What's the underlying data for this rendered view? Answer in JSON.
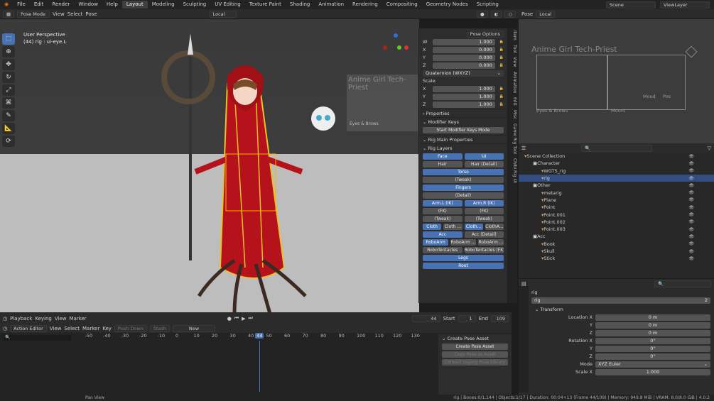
{
  "topbar": {
    "menus": [
      "File",
      "Edit",
      "Render",
      "Window",
      "Help"
    ],
    "workspaces": [
      "Layout",
      "Modeling",
      "Sculpting",
      "UV Editing",
      "Texture Paint",
      "Shading",
      "Animation",
      "Rendering",
      "Compositing",
      "Geometry Nodes",
      "Scripting"
    ],
    "active_workspace": "Layout",
    "scene": "Scene",
    "view_layer": "ViewLayer"
  },
  "viewport_header": {
    "mode": "Pose Mode",
    "menus": [
      "View",
      "Select",
      "Pose"
    ],
    "orientation": "Local",
    "pose_options": "Pose Options"
  },
  "viewport": {
    "perspective": "User Perspective",
    "selection": "(44) rig : ui-eye.L",
    "overlay_title": "Anime Girl Tech-Priest",
    "overlay_label": "Eyes & Brows"
  },
  "npanel": {
    "transform_rows": [
      {
        "label": "W",
        "value": "1.000"
      },
      {
        "label": "X",
        "value": "0.000"
      },
      {
        "label": "Y",
        "value": "0.000"
      },
      {
        "label": "Z",
        "value": "0.000"
      }
    ],
    "rotation_mode": "Quaternion (WXYZ)",
    "scale_label": "Scale:",
    "scale_rows": [
      {
        "label": "X",
        "value": "1.000"
      },
      {
        "label": "Y",
        "value": "1.000"
      },
      {
        "label": "Z",
        "value": "1.000"
      }
    ],
    "properties": "Properties",
    "modifier_keys": "Modifier Keys",
    "start_modifier": "Start Modifier Keys Mode",
    "rig_main": "Rig Main Properties",
    "rig_layers": "Rig Layers",
    "layers": [
      [
        "Face",
        "UI"
      ],
      [
        "Hair",
        "Hair (Detail)"
      ],
      [
        "Torso"
      ],
      [
        "(Tweak)"
      ],
      [
        "Fingers"
      ],
      [
        "(Detail)"
      ],
      [
        "Arm.L (IK)",
        "Arm.R (IK)"
      ],
      [
        "(FK)",
        "(FK)"
      ],
      [
        "(Tweak)",
        "(Tweak)"
      ],
      [
        "Cloth",
        "Cloth ...",
        "Cloth...",
        "ClothA..."
      ],
      [
        "Acc",
        "Acc (Detail)"
      ],
      [
        "RoboArm",
        "RoboArm ...",
        "RoboArm ..."
      ],
      [
        "RoboTentacles",
        "RoboTentacles (FK)"
      ],
      [
        "Legs"
      ],
      [
        "Root"
      ]
    ]
  },
  "vtabs": [
    "Item",
    "Tool",
    "View",
    "Animation",
    "Edit",
    "Misc",
    "Game Rig Tool",
    "Chibi Rig UI"
  ],
  "right_preview": {
    "title": "Anime Girl Tech-Priest",
    "labels": [
      "Eyes & Brows",
      "Mount",
      "Mood",
      "Pos"
    ]
  },
  "outliner": {
    "search_placeholder": "",
    "items": [
      {
        "label": "Scene Collection",
        "indent": 0
      },
      {
        "label": "Character",
        "indent": 1
      },
      {
        "label": "WGTS_rig",
        "indent": 2
      },
      {
        "label": "rig",
        "indent": 2,
        "selected": true
      },
      {
        "label": "Other",
        "indent": 1
      },
      {
        "label": "metarig",
        "indent": 2
      },
      {
        "label": "Plane",
        "indent": 2
      },
      {
        "label": "Point",
        "indent": 2
      },
      {
        "label": "Point.001",
        "indent": 2
      },
      {
        "label": "Point.002",
        "indent": 2
      },
      {
        "label": "Point.003",
        "indent": 2
      },
      {
        "label": "Acc",
        "indent": 1
      },
      {
        "label": "Book",
        "indent": 2
      },
      {
        "label": "Skull",
        "indent": 2
      },
      {
        "label": "Stick",
        "indent": 2
      }
    ]
  },
  "properties": {
    "object_name": "rig",
    "data_name": "rig",
    "users": "2",
    "transform": "Transform",
    "location": [
      {
        "label": "Location X",
        "value": "0 m"
      },
      {
        "label": "Y",
        "value": "0 m"
      },
      {
        "label": "Z",
        "value": "0 m"
      }
    ],
    "rotation": [
      {
        "label": "Rotation X",
        "value": "0°"
      },
      {
        "label": "Y",
        "value": "0°"
      },
      {
        "label": "Z",
        "value": "0°"
      }
    ],
    "mode_label": "Mode",
    "mode_value": "XYZ Euler",
    "scale_label": "Scale X",
    "scale_value": "1.000"
  },
  "timeline": {
    "menus": [
      "Playback",
      "Keying",
      "View",
      "Marker"
    ],
    "current_frame": "44",
    "start_label": "Start",
    "start": "1",
    "end_label": "End",
    "end": "109"
  },
  "action_editor": {
    "mode": "Action Editor",
    "menus": [
      "View",
      "Select",
      "Marker",
      "Key"
    ],
    "push_down": "Push Down",
    "stash": "Stash",
    "new": "New",
    "ticks": [
      "-50",
      "-40",
      "-30",
      "-20",
      "-10",
      "0",
      "10",
      "20",
      "30",
      "40",
      "44",
      "50",
      "60",
      "70",
      "80",
      "90",
      "100",
      "110",
      "120",
      "130"
    ]
  },
  "pose_asset": {
    "header": "Create Pose Asset",
    "create": "Create Pose Asset",
    "copy": "Copy Pose as Asset",
    "convert": "Convert Legacy Pose Library"
  },
  "status": {
    "left": "Pan View",
    "right": "rig | Bones:0/1,144 | Objects:1/17 | Duration: 00:04+13 (Frame 44/109) | Memory: 949.8 MiB | VRAM: 8.0/8.0 GiB | 4.0.2"
  }
}
